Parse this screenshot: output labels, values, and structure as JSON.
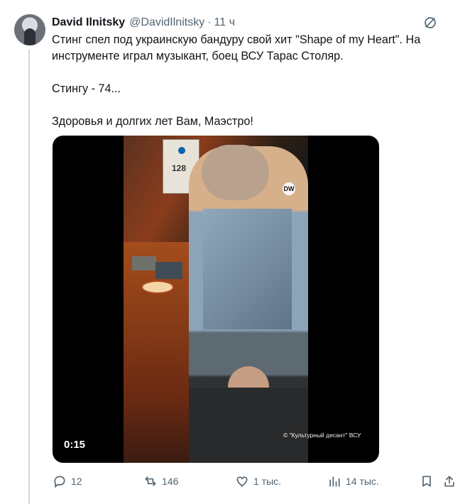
{
  "author": {
    "name": "David Ilnitsky",
    "handle": "@DavidIlnitsky",
    "separator": "·",
    "time": "11 ч"
  },
  "tweet": {
    "text": "Стинг спел под украинскую бандуру свой хит \"Shape of my Heart\". На инструменте играл музыкант, боец ВСУ Тарас Столяр.\n\nСтингу - 74...\n\nЗдоровья и долгих лет Вам, Маэстро!"
  },
  "media": {
    "poster_number": "128",
    "watermark": "DW",
    "credit": "© \"Культурный десант\" ВСУ",
    "duration": "0:15"
  },
  "actions": {
    "reply_count": "12",
    "retweet_count": "146",
    "like_count": "1 тыс.",
    "views_count": "14 тыс."
  },
  "colors": {
    "text": "#0f1419",
    "secondary": "#536471",
    "line": "#cfd9de"
  }
}
